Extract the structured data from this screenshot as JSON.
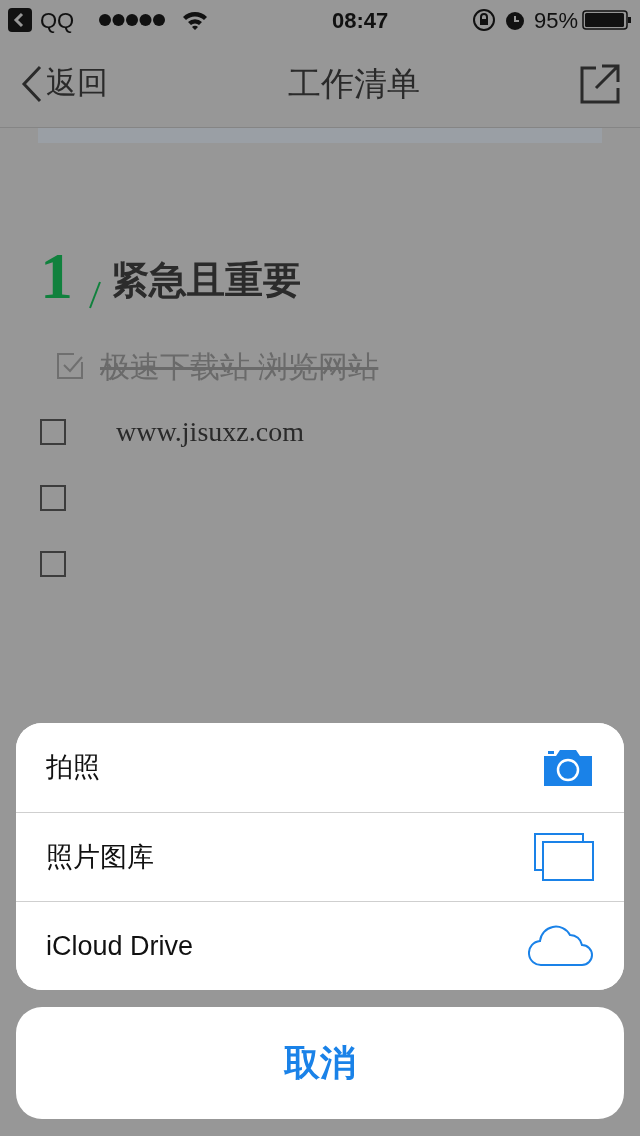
{
  "status_bar": {
    "back_app": "QQ",
    "time": "08:47",
    "battery": "95%"
  },
  "nav": {
    "back": "返回",
    "title": "工作清单"
  },
  "section": {
    "number": "1",
    "title": "紧急且重要",
    "items": [
      {
        "text": "极速下载站 浏览网站",
        "checked": true
      },
      {
        "text": "www.jisuxz.com",
        "checked": false
      },
      {
        "checked": false
      },
      {
        "checked": false
      }
    ]
  },
  "action_sheet": {
    "options": [
      {
        "label": "拍照",
        "kind": "camera"
      },
      {
        "label": "照片图库",
        "kind": "photos"
      },
      {
        "label": "iCloud Drive",
        "kind": "cloud"
      }
    ],
    "cancel": "取消"
  }
}
